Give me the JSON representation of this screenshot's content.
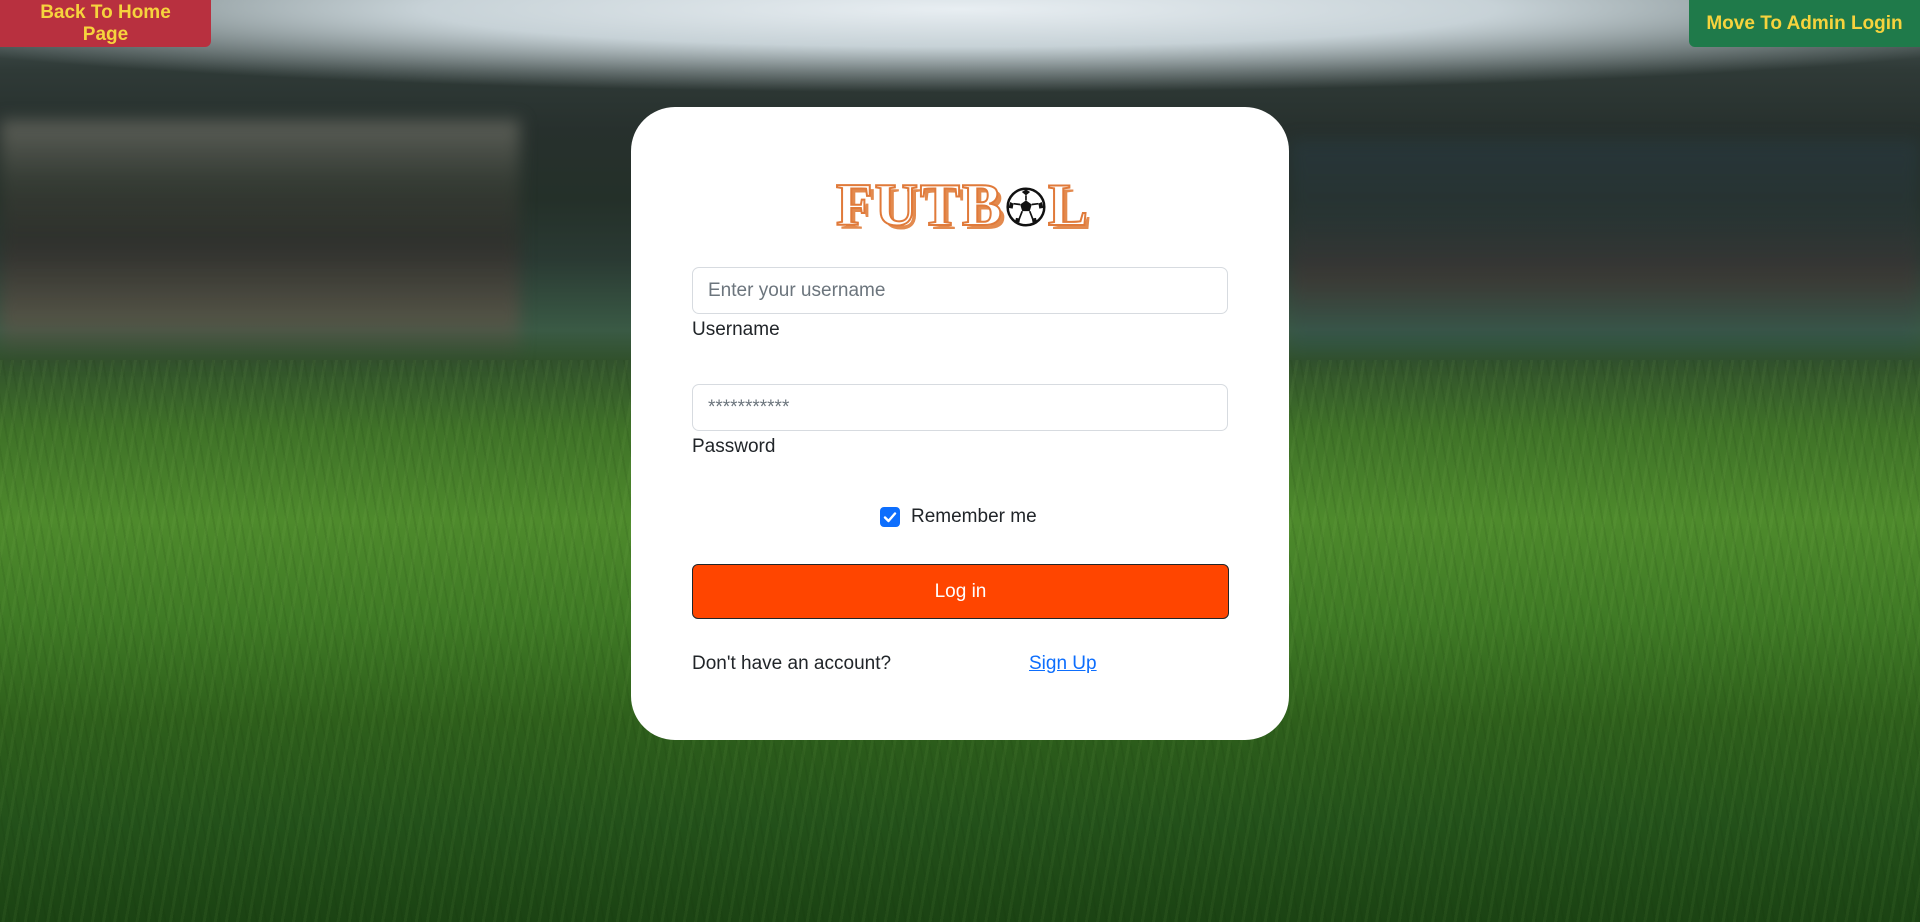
{
  "nav": {
    "home_label": "Back To Home Page",
    "admin_label": "Move To Admin Login"
  },
  "logo": {
    "text_before": "FUTB",
    "text_after": "L",
    "ball_icon": "soccer-ball-icon",
    "color": "#e07a3a"
  },
  "form": {
    "username_placeholder": "Enter your username",
    "username_value": "",
    "username_label": "Username",
    "password_placeholder": "***********",
    "password_value": "",
    "password_label": "Password",
    "remember_label": "Remember me",
    "remember_checked": true,
    "login_label": "Log in",
    "no_account_text": "Don't have an account?",
    "signup_label": "Sign Up"
  },
  "colors": {
    "home_button": "#b8303f",
    "admin_button": "#1f7a4a",
    "nav_text": "#f6d33d",
    "login_button": "#ff4500",
    "link": "#0d6efd"
  }
}
